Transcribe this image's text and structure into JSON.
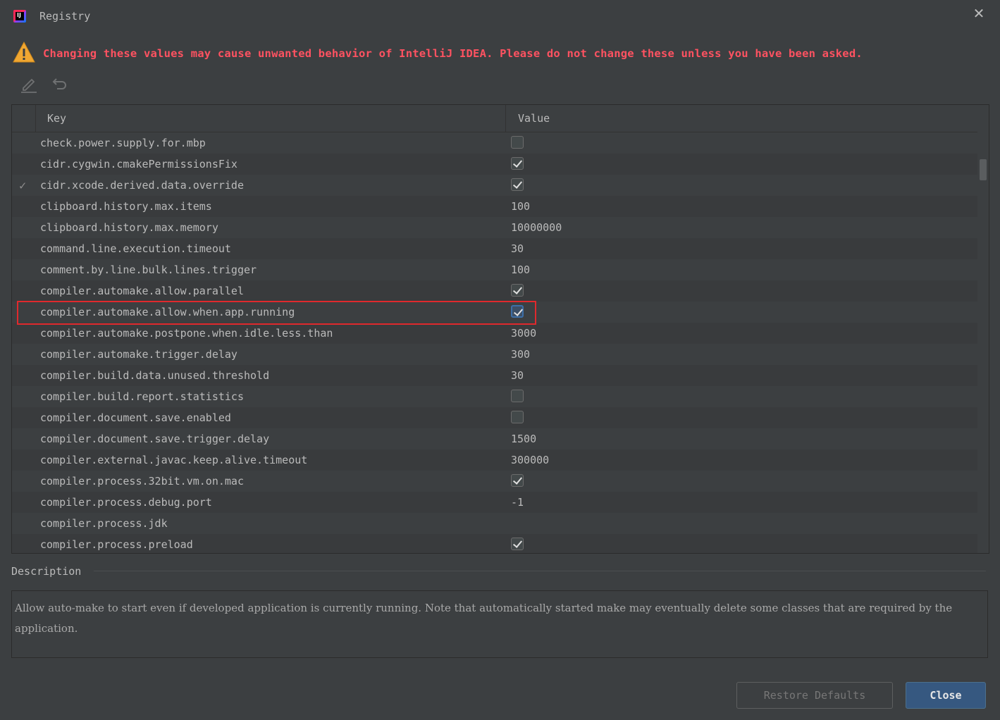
{
  "window": {
    "title": "Registry"
  },
  "warning": {
    "text": "Changing these values may cause unwanted behavior of IntelliJ IDEA. Please do not change these unless you have been asked."
  },
  "toolbar": {
    "edit_icon": "pencil-icon",
    "revert_icon": "undo-icon"
  },
  "table": {
    "headers": {
      "key": "Key",
      "value": "Value"
    },
    "rows": [
      {
        "key": "check.power.supply.for.mbp",
        "type": "bool",
        "value": "false"
      },
      {
        "key": "cidr.cygwin.cmakePermissionsFix",
        "type": "bool",
        "value": "true"
      },
      {
        "key": "cidr.xcode.derived.data.override",
        "type": "bool",
        "value": "true",
        "modified": true
      },
      {
        "key": "clipboard.history.max.items",
        "type": "text",
        "value": "100"
      },
      {
        "key": "clipboard.history.max.memory",
        "type": "text",
        "value": "10000000"
      },
      {
        "key": "command.line.execution.timeout",
        "type": "text",
        "value": "30"
      },
      {
        "key": "comment.by.line.bulk.lines.trigger",
        "type": "text",
        "value": "100"
      },
      {
        "key": "compiler.automake.allow.parallel",
        "type": "bool",
        "value": "true"
      },
      {
        "key": "compiler.automake.allow.when.app.running",
        "type": "bool",
        "value": "true",
        "selected": true
      },
      {
        "key": "compiler.automake.postpone.when.idle.less.than",
        "type": "text",
        "value": "3000"
      },
      {
        "key": "compiler.automake.trigger.delay",
        "type": "text",
        "value": "300"
      },
      {
        "key": "compiler.build.data.unused.threshold",
        "type": "text",
        "value": "30"
      },
      {
        "key": "compiler.build.report.statistics",
        "type": "bool",
        "value": "false"
      },
      {
        "key": "compiler.document.save.enabled",
        "type": "bool",
        "value": "false"
      },
      {
        "key": "compiler.document.save.trigger.delay",
        "type": "text",
        "value": "1500"
      },
      {
        "key": "compiler.external.javac.keep.alive.timeout",
        "type": "text",
        "value": "300000"
      },
      {
        "key": "compiler.process.32bit.vm.on.mac",
        "type": "bool",
        "value": "true"
      },
      {
        "key": "compiler.process.debug.port",
        "type": "text",
        "value": "-1"
      },
      {
        "key": "compiler.process.jdk",
        "type": "text",
        "value": ""
      },
      {
        "key": "compiler.process.preload",
        "type": "bool",
        "value": "true"
      }
    ]
  },
  "description": {
    "label": "Description",
    "text": "Allow auto-make to start even if developed application is currently running. Note that automatically started make may eventually delete some classes that are required by the application."
  },
  "buttons": {
    "restore": "Restore Defaults",
    "close": "Close"
  },
  "colors": {
    "warning": "#ff5261",
    "highlight": "#e0292d",
    "primary_button": "#365880"
  }
}
